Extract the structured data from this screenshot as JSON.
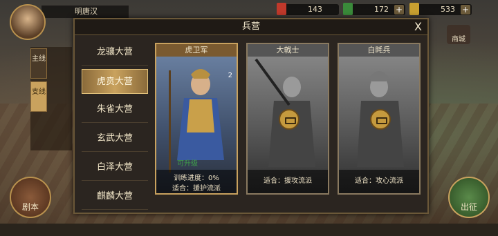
{
  "player": {
    "name": "明唐汉"
  },
  "resources": [
    {
      "icon": "scroll-icon",
      "value": "143",
      "color": "#c0392b"
    },
    {
      "icon": "jade-icon",
      "value": "172",
      "color": "#3a8a3a"
    },
    {
      "icon": "gold-icon",
      "value": "533",
      "color": "#c8a030"
    }
  ],
  "topright": {
    "shop": "商城"
  },
  "quest": {
    "main_tab": "主线",
    "branch_tab": "支线"
  },
  "modal": {
    "title": "兵营",
    "close": "X",
    "menu": [
      {
        "label": "龙骧大营",
        "active": false
      },
      {
        "label": "虎贲大营",
        "active": true
      },
      {
        "label": "朱雀大营",
        "active": false
      },
      {
        "label": "玄武大营",
        "active": false
      },
      {
        "label": "白泽大营",
        "active": false
      },
      {
        "label": "麒麟大营",
        "active": false
      }
    ],
    "cards": [
      {
        "name": "虎卫军",
        "badge": "2",
        "progress": "训练进度：0%",
        "fit": "适合：援护流派",
        "locked": false,
        "bg_text": "可升级"
      },
      {
        "name": "大戟士",
        "fit": "适合：援攻流派",
        "locked": true
      },
      {
        "name": "白眊兵",
        "fit": "适合：攻心流派",
        "locked": true
      }
    ]
  },
  "bottom": {
    "script": "剧本",
    "attack": "出征"
  }
}
